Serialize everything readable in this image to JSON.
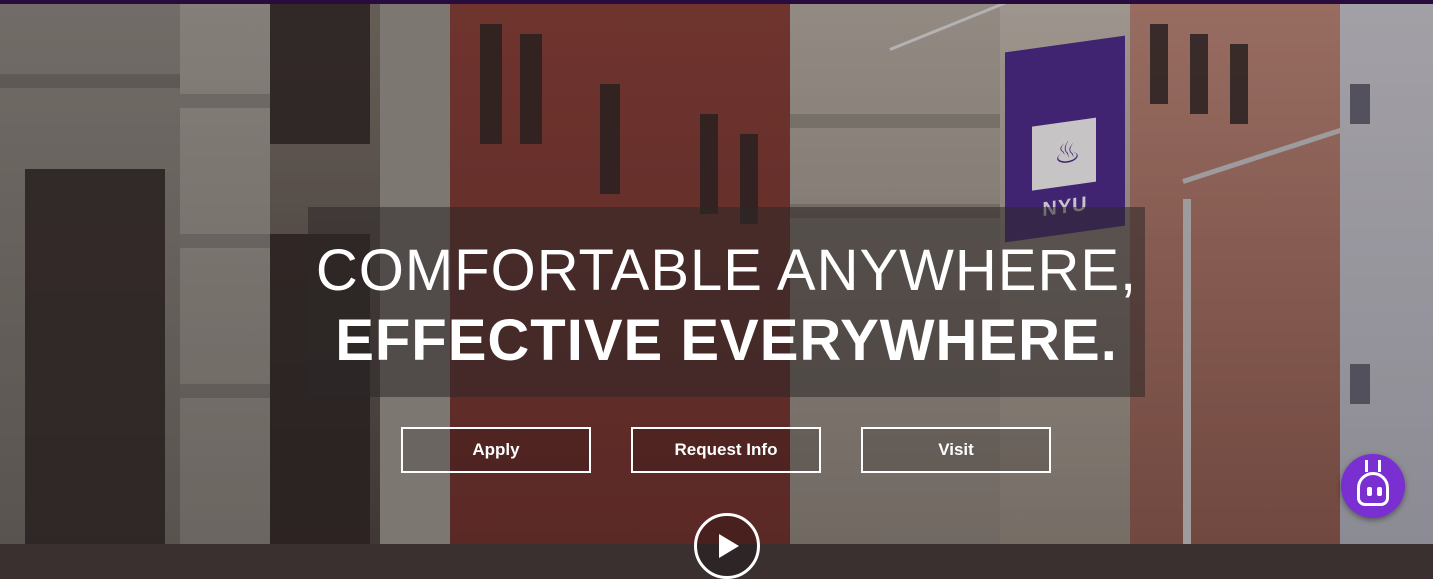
{
  "hero": {
    "headline_line1": "COMFORTABLE ANYWHERE,",
    "headline_line2": "EFFECTIVE EVERYWHERE.",
    "background_flag_text": "NYU"
  },
  "cta": {
    "apply_label": "Apply",
    "request_info_label": "Request Info",
    "visit_label": "Visit"
  },
  "icons": {
    "play": "play-icon",
    "chatbot": "chatbot-icon",
    "flag_torch": "torch-icon"
  },
  "colors": {
    "accent_purple": "#57068c",
    "chatbot_purple": "#7a2fd1",
    "text": "#ffffff"
  }
}
